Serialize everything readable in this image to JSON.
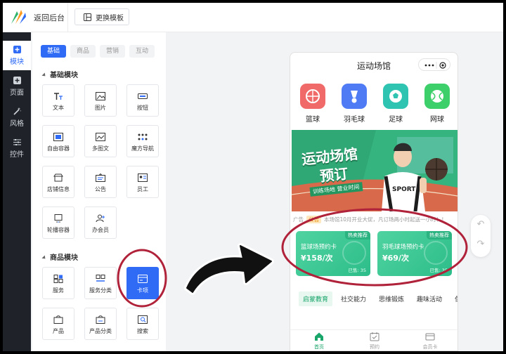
{
  "topbar": {
    "back_label": "返回后台",
    "template_button": "更换模板"
  },
  "rail": {
    "items": [
      {
        "label": "模块",
        "icon": "plus-square-icon",
        "active": true
      },
      {
        "label": "页面",
        "icon": "plus-square-icon",
        "active": false
      },
      {
        "label": "风格",
        "icon": "wand-icon",
        "active": false
      },
      {
        "label": "控件",
        "icon": "sliders-icon",
        "active": false
      }
    ]
  },
  "panel": {
    "tabs": [
      "基础",
      "商品",
      "营销",
      "互动"
    ],
    "basic_title": "基础模块",
    "basic_items": [
      "文本",
      "图片",
      "按钮",
      "自由容器",
      "多图文",
      "魔方导航",
      "店铺信息",
      "公告",
      "员工",
      "轮播容器",
      "办会员"
    ],
    "goods_title": "商品模块",
    "goods_items": [
      "服务",
      "服务分类",
      "卡项",
      "产品",
      "产品分类",
      "搜索"
    ]
  },
  "phone": {
    "title": "运动场馆",
    "categories": [
      {
        "label": "篮球",
        "color": "#f06a6a"
      },
      {
        "label": "羽毛球",
        "color": "#4f7cf5"
      },
      {
        "label": "足球",
        "color": "#2fc4b2"
      },
      {
        "label": "网球",
        "color": "#3ccf6a"
      }
    ],
    "banner": {
      "title_line1": "运动场馆",
      "title_line2": "预订",
      "subtitle": "训练场地 营业时间",
      "jersey_text": "SPORT"
    },
    "notice": {
      "prefix": "广告",
      "tag": "公告",
      "text": "本场馆10月开业大促，凡订场两小时起送一小时！！"
    },
    "cards": [
      {
        "badge": "热卖推荐",
        "title": "篮球场预约卡",
        "price": "¥158/次",
        "sold": "已售: 35"
      },
      {
        "badge": "热卖推荐",
        "title": "羽毛球场预约卡",
        "price": "¥69/次",
        "sold": "已售: 35"
      }
    ],
    "chips": [
      "启蒙教育",
      "社交能力",
      "思维锻炼",
      "趣味活动",
      "保养"
    ],
    "tabbar": [
      {
        "label": "首页",
        "icon": "home-icon",
        "active": true
      },
      {
        "label": "预约",
        "icon": "calendar-icon",
        "active": false
      },
      {
        "label": "会员卡",
        "icon": "card-icon",
        "active": false
      }
    ]
  },
  "colors": {
    "accent": "#2f6bf5",
    "green": "#1aa56a",
    "annotation": "#b0223a"
  }
}
